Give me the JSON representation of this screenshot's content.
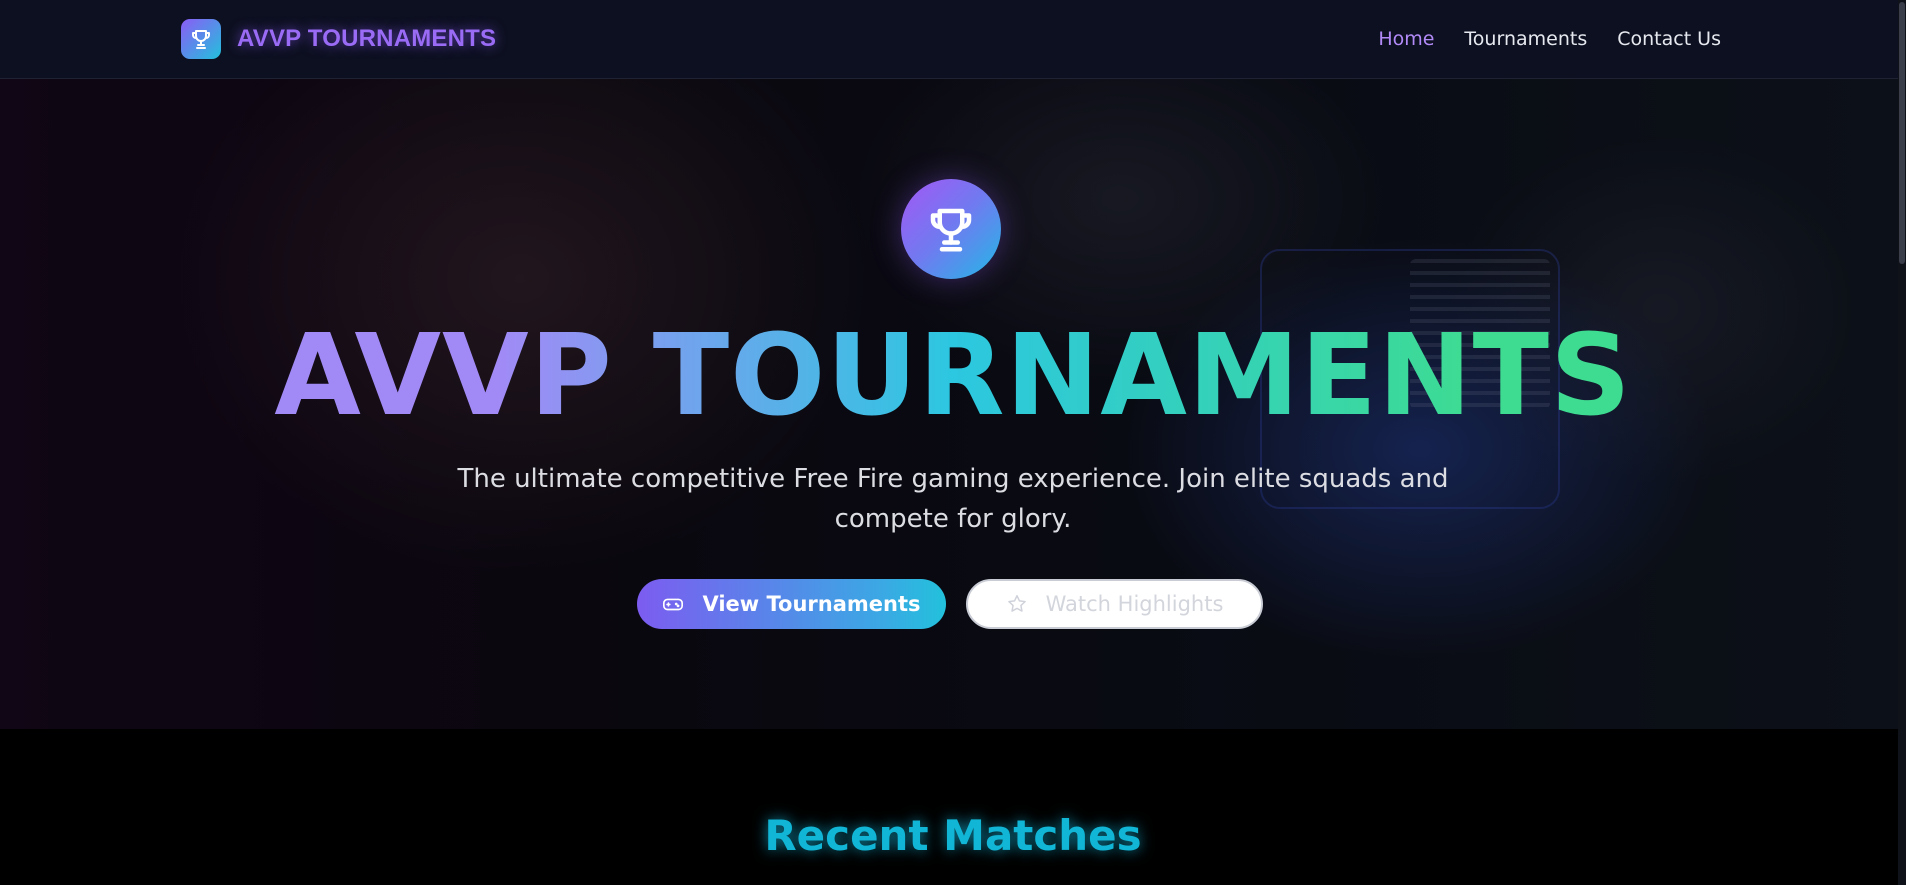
{
  "navbar": {
    "brand_name": "AVVP TOURNAMENTS",
    "links": [
      {
        "label": "Home",
        "active": true
      },
      {
        "label": "Tournaments",
        "active": false
      },
      {
        "label": "Contact Us",
        "active": false
      }
    ]
  },
  "hero": {
    "icon": "trophy-icon",
    "title": "AVVP TOURNAMENTS",
    "subtitle": "The ultimate competitive Free Fire gaming experience. Join elite squads and compete for glory.",
    "primary_button": {
      "label": "View Tournaments",
      "icon": "gamepad-icon"
    },
    "secondary_button": {
      "label": "Watch Highlights",
      "icon": "star-icon"
    }
  },
  "recent_matches": {
    "title": "Recent Matches"
  },
  "colors": {
    "brand_purple": "#9a6bf5",
    "accent_cyan": "#22c1dc",
    "accent_green": "#3edc90",
    "active_link": "#b18af7"
  }
}
